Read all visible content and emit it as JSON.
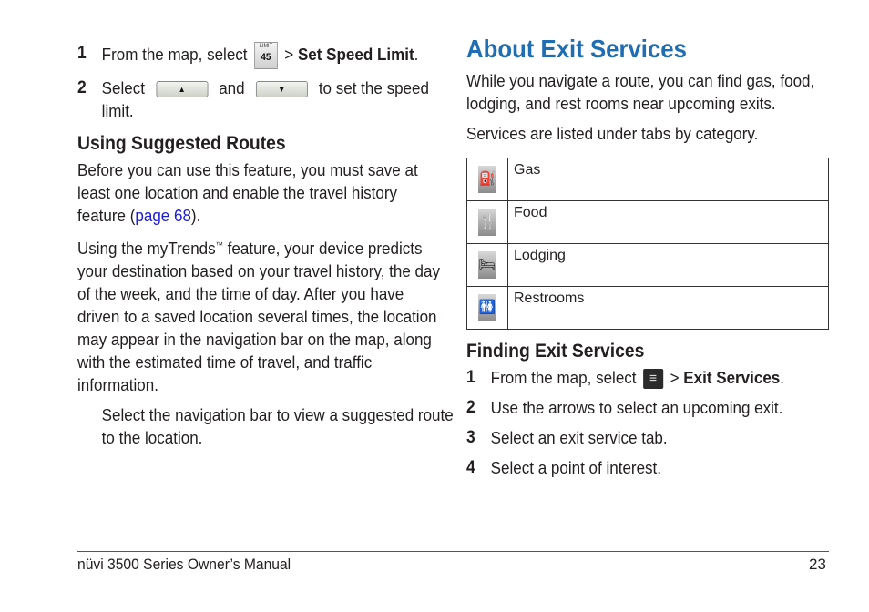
{
  "left": {
    "steps_speed": [
      {
        "num": "1",
        "pre": "From the map, select",
        "icon": "speed-limit-icon",
        "icon_top": "LIMIT",
        "icon_value": "45",
        "sep": ">",
        "bold": "Set Speed Limit",
        "post": "."
      },
      {
        "num": "2",
        "pre": "Select",
        "btn_up": "▲",
        "mid": "and",
        "btn_down": "▼",
        "post": "to set the speed limit."
      }
    ],
    "heading": "Using Suggested Routes",
    "para1_pre": "Before you can use this feature, you must save at least one location and enable the travel history feature (",
    "para1_link": "page 68",
    "para1_post": ").",
    "para2_pre": "Using the myTrends",
    "para2_tm": "™",
    "para2_post": " feature, your device predicts your destination based on your travel history, the day of the week, and the time of day. After you have driven to a saved location several times, the location may appear in the navigation bar on the map, along with the estimated time of travel, and traffic information.",
    "instruction": "Select the navigation bar to view a suggested route to the location."
  },
  "right": {
    "title": "About Exit Services",
    "intro": "While you navigate a route, you can find gas, food, lodging, and rest rooms near upcoming exits.",
    "tabs_intro": "Services are listed under tabs by category.",
    "services": [
      {
        "icon": "⛽",
        "label": "Gas"
      },
      {
        "icon": "🍴",
        "label": "Food"
      },
      {
        "icon": "🛏",
        "label": "Lodging"
      },
      {
        "icon": "🚻",
        "label": "Restrooms"
      }
    ],
    "heading": "Finding Exit Services",
    "steps": [
      {
        "num": "1",
        "pre": "From the map, select",
        "icon": "≡",
        "sep": ">",
        "bold": "Exit Services",
        "post": "."
      },
      {
        "num": "2",
        "text": "Use the arrows to select an upcoming exit."
      },
      {
        "num": "3",
        "text": "Select an exit service tab."
      },
      {
        "num": "4",
        "text": "Select a point of interest."
      }
    ]
  },
  "footer": {
    "manual": "nüvi 3500 Series Owner’s Manual",
    "page": "23"
  },
  "colors": {
    "title": "#1f6db3",
    "link": "#1c1cd6"
  }
}
